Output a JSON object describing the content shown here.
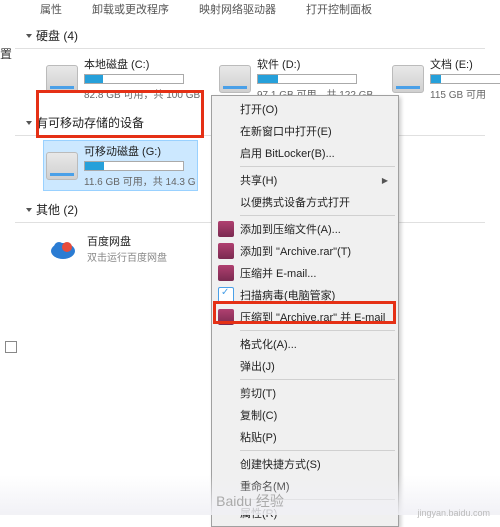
{
  "tabs": [
    "属性",
    "卸载或更改程序",
    "映射网络驱动器",
    "打开控制面板"
  ],
  "settings_label": "置",
  "sections": {
    "hdd": "硬盘 (4)",
    "removable": "有可移动存储的设备",
    "other": "其他 (2)"
  },
  "drives": {
    "c": {
      "name": "本地磁盘 (C:)",
      "status": "82.8 GB 可用，共 100 GB",
      "fill_pct": 18
    },
    "d": {
      "name": "软件 (D:)",
      "status": "97.1 GB 可用，共 122 GB",
      "fill_pct": 20
    },
    "e": {
      "name": "文档 (E:)",
      "status": "115 GB 可用",
      "fill_pct": 10
    },
    "g": {
      "name": "可移动磁盘 (G:)",
      "status": "11.6 GB 可用，共 14.3 G",
      "fill_pct": 19
    }
  },
  "other_items": {
    "baidu": {
      "name": "百度网盘",
      "sub": "双击运行百度网盘"
    }
  },
  "menu": {
    "open": "打开(O)",
    "new_window": "在新窗口中打开(E)",
    "bitlocker": "启用 BitLocker(B)...",
    "share": "共享(H)",
    "portable_open": "以便携式设备方式打开",
    "add_archive": "添加到压缩文件(A)...",
    "add_to_rar": "添加到 \"Archive.rar\"(T)",
    "compress_email": "压缩并 E-mail...",
    "scan_virus": "扫描病毒(电脑管家)",
    "compress_rar_email": "压缩到 \"Archive.rar\" 并 E-mail",
    "format": "格式化(A)...",
    "eject": "弹出(J)",
    "cut": "剪切(T)",
    "copy": "复制(C)",
    "paste": "粘贴(P)",
    "create_shortcut": "创建快捷方式(S)",
    "rename": "重命名(M)",
    "properties": "属性(R)"
  },
  "watermark": {
    "brand": "Baidu 经验",
    "url": "jingyan.baidu.com"
  }
}
